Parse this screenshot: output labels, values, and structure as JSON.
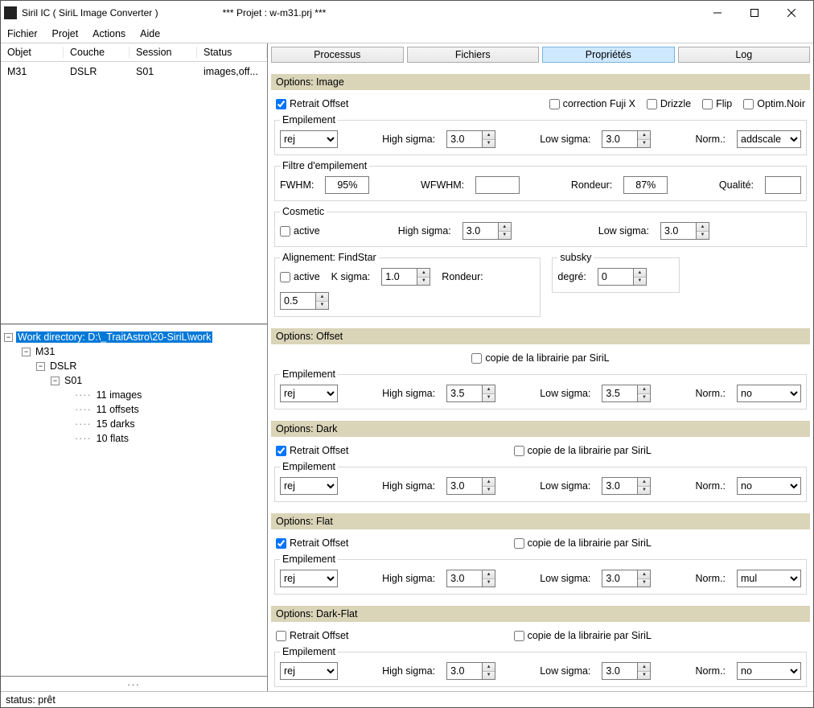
{
  "title": "Siril IC   ( SiriL Image Converter )",
  "project": "*** Projet : w-m31.prj ***",
  "menu": {
    "fichier": "Fichier",
    "projet": "Projet",
    "actions": "Actions",
    "aide": "Aide"
  },
  "objTable": {
    "headers": {
      "objet": "Objet",
      "couche": "Couche",
      "session": "Session",
      "status": "Status"
    },
    "row": {
      "objet": "M31",
      "couche": "DSLR",
      "session": "S01",
      "status": "images,off..."
    }
  },
  "tree": {
    "root": "Work directory: D:\\_TraitAstro\\20-SiriL\\work",
    "n1": "M31",
    "n2": "DSLR",
    "n3": "S01",
    "leaf1": "11 images",
    "leaf2": "11 offsets",
    "leaf3": "15 darks",
    "leaf4": "10 flats"
  },
  "ellipsis": "...",
  "tabs": {
    "processus": "Processus",
    "fichiers": "Fichiers",
    "proprietes": "Propriétés",
    "log": "Log"
  },
  "labels": {
    "retrait_offset": "Retrait Offset",
    "copie_lib": "copie de la librairie par SiriL",
    "correction_fuji": "correction Fuji X",
    "drizzle": "Drizzle",
    "flip": "Flip",
    "optim_noir": "Optim.Noir",
    "empilement": "Empilement",
    "high_sigma": "High sigma:",
    "low_sigma": "Low sigma:",
    "norm": "Norm.:",
    "filtre_empilement": "Filtre d'empilement",
    "fwhm": "FWHM:",
    "wfwhm": "WFWHM:",
    "rondeur": "Rondeur:",
    "qualite": "Qualité:",
    "cosmetic": "Cosmetic",
    "active": "active",
    "alignement": "Alignement: FindStar",
    "ksigma": "K sigma:",
    "subsky": "subsky",
    "degre": "degré:",
    "sec_image": "Options: Image",
    "sec_offset": "Options: Offset",
    "sec_dark": "Options: Dark",
    "sec_flat": "Options: Flat",
    "sec_darkflat": "Options: Dark-Flat"
  },
  "options": {
    "image": {
      "retrait_offset": true,
      "fuji": false,
      "drizzle": false,
      "flip": false,
      "optim_noir": false,
      "empilement": "rej",
      "high_sigma": "3.0",
      "low_sigma": "3.0",
      "norm": "addscale",
      "fwhm": "95%",
      "wfwhm": "",
      "rondeur_f": "87%",
      "qualite": "",
      "cos_active": false,
      "cos_high": "3.0",
      "cos_low": "3.0",
      "align_active": false,
      "ksigma": "1.0",
      "rondeur_a": "0.5",
      "subsky_deg": "0"
    },
    "offset": {
      "copie_lib": false,
      "empilement": "rej",
      "high_sigma": "3.5",
      "low_sigma": "3.5",
      "norm": "no"
    },
    "dark": {
      "retrait_offset": true,
      "copie_lib": false,
      "empilement": "rej",
      "high_sigma": "3.0",
      "low_sigma": "3.0",
      "norm": "no"
    },
    "flat": {
      "retrait_offset": true,
      "copie_lib": false,
      "empilement": "rej",
      "high_sigma": "3.0",
      "low_sigma": "3.0",
      "norm": "mul"
    },
    "darkflat": {
      "retrait_offset": false,
      "copie_lib": false,
      "empilement": "rej",
      "high_sigma": "3.0",
      "low_sigma": "3.0",
      "norm": "no"
    }
  },
  "status": "status: prêt"
}
